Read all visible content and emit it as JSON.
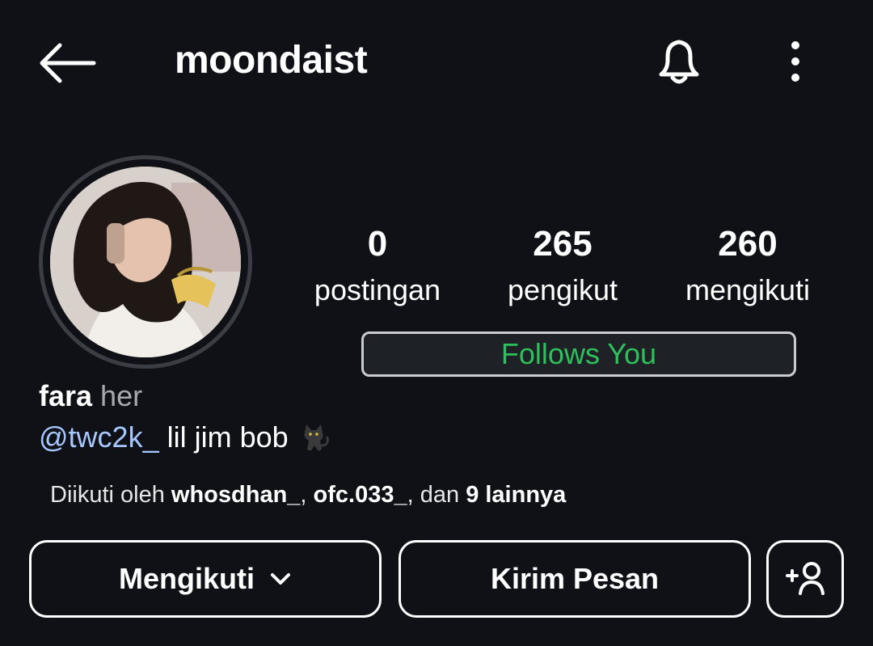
{
  "header": {
    "username": "moondaist"
  },
  "stats": [
    {
      "value": "0",
      "label": "postingan"
    },
    {
      "value": "265",
      "label": "pengikut"
    },
    {
      "value": "260",
      "label": "mengikuti"
    }
  ],
  "badge": {
    "follows_you": "Follows You",
    "color": "#2ec05a"
  },
  "bio": {
    "name": "fara",
    "pronoun": "her",
    "mention": "@twc2k_",
    "text": "lil jim bob",
    "emoji_icon": "black-cat-icon"
  },
  "followed_by": {
    "prefix": "Diikuti oleh ",
    "user1": "whosdhan_",
    "separator": ", ",
    "user2": "ofc.033_",
    "middle": ", dan ",
    "others": "9 lainnya"
  },
  "actions": {
    "following_label": "Mengikuti",
    "message_label": "Kirim Pesan"
  },
  "icons": [
    "back-arrow-icon",
    "bell-icon",
    "more-vertical-icon",
    "chevron-down-icon",
    "add-person-icon"
  ],
  "colors": {
    "background": "#0f1117",
    "mention": "#a7c7ff",
    "follows_you": "#2ec05a"
  }
}
